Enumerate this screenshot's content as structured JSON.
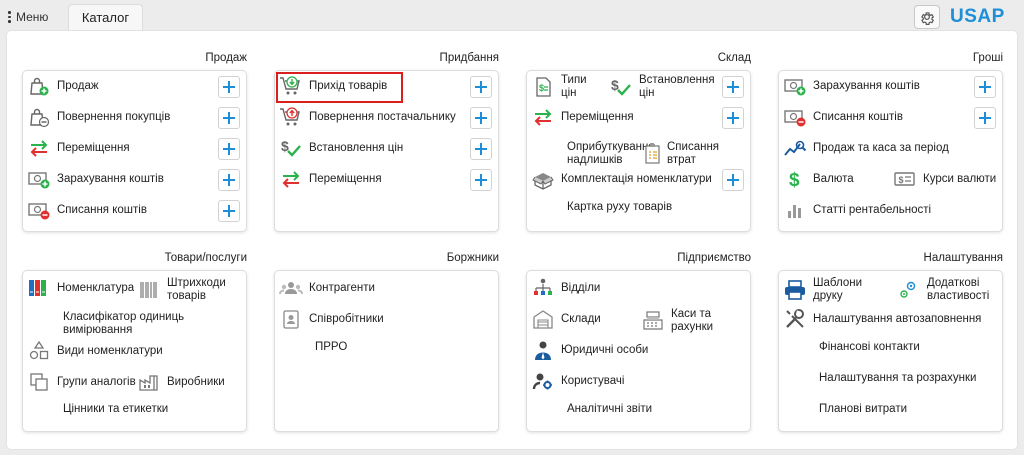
{
  "topbar": {
    "menu_label": "Меню",
    "tab_label": "Каталог",
    "logo_text": "USAP",
    "gear_icon": "gear-icon"
  },
  "sections": {
    "prodazh": {
      "title": "Продаж",
      "items": [
        "Продаж",
        "Повернення покупців",
        "Переміщення",
        "Зарахування коштів",
        "Списання коштів"
      ]
    },
    "prydbannia": {
      "title": "Придбання",
      "items": [
        "Прихід товарів",
        "Повернення постачальнику",
        "Встановлення цін",
        "Переміщення"
      ]
    },
    "sklad": {
      "title": "Склад",
      "items": [
        "Типи\nцін",
        "Встановлення\nцін",
        "Переміщення",
        "Оприбуткування\nнадлишків",
        "Списання\nвтрат",
        "Комплектація номенклатури",
        "Картка руху товарів"
      ]
    },
    "groshi": {
      "title": "Гроші",
      "items": [
        "Зарахування коштів",
        "Списання коштів",
        "Продаж та каса за період",
        "Валюта",
        "Курси валюти",
        "Статті рентабельності"
      ]
    },
    "tovary": {
      "title": "Товари/послуги",
      "items": [
        "Номенклатура",
        "Штрихкоди\nтоварів",
        "Класифікатор одиниць\nвимірювання",
        "Види номенклатури",
        "Групи аналогів",
        "Виробники",
        "Цінники та етикетки"
      ]
    },
    "borzhnyky": {
      "title": "Боржники",
      "items": [
        "Контрагенти",
        "Співробітники",
        "ПРРО"
      ]
    },
    "pidpryiemstvo": {
      "title": "Підприємство",
      "items": [
        "Відділи",
        "Склади",
        "Каси та\nрахунки",
        "Юридичні особи",
        "Користувачі",
        "Аналітичні звіти"
      ]
    },
    "nalashtuvannia": {
      "title": "Налаштування",
      "items": [
        "Шаблони\nдруку",
        "Додаткові\nвластивості",
        "Налаштування автозаповнення",
        "Фінансові контакти",
        "Налаштування та розрахунки",
        "Планові витрати"
      ]
    }
  },
  "colors": {
    "accent_blue": "#1d8ed8",
    "green": "#2bb24c",
    "red": "#e03131",
    "highlight": "#d9201f"
  },
  "highlighted_item": "Прихід товарів"
}
